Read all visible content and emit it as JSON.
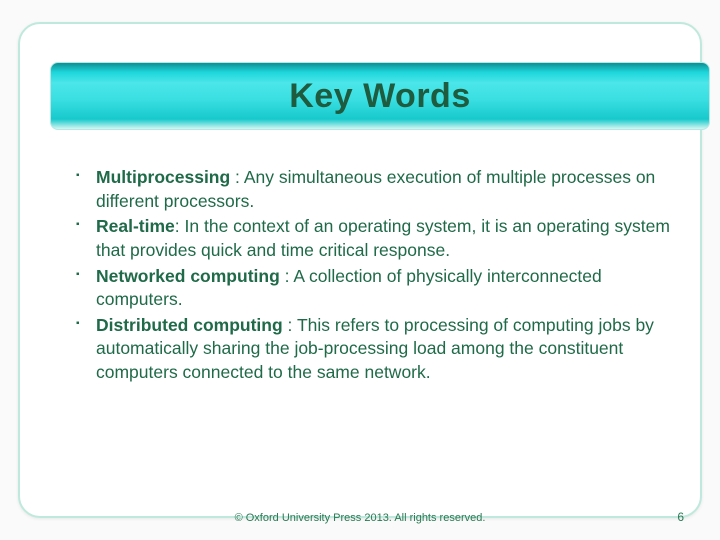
{
  "title": "Key Words",
  "items": [
    {
      "term": "Multiprocessing ",
      "sep": ": ",
      "def": "Any simultaneous execution of multiple processes on different processors."
    },
    {
      "term": "Real-time",
      "sep": ": ",
      "def": "In the context of an operating system, it is an operating system that provides quick and time critical response."
    },
    {
      "term": "Networked computing ",
      "sep": ": ",
      "def": "A collection of physically interconnected computers."
    },
    {
      "term": "Distributed computing ",
      "sep": ": ",
      "def": "This refers to processing of computing jobs by automatically sharing the job-processing load among the constituent computers connected to the same network."
    }
  ],
  "footer": "© Oxford University Press 2013. All rights reserved.",
  "page_number": "6"
}
